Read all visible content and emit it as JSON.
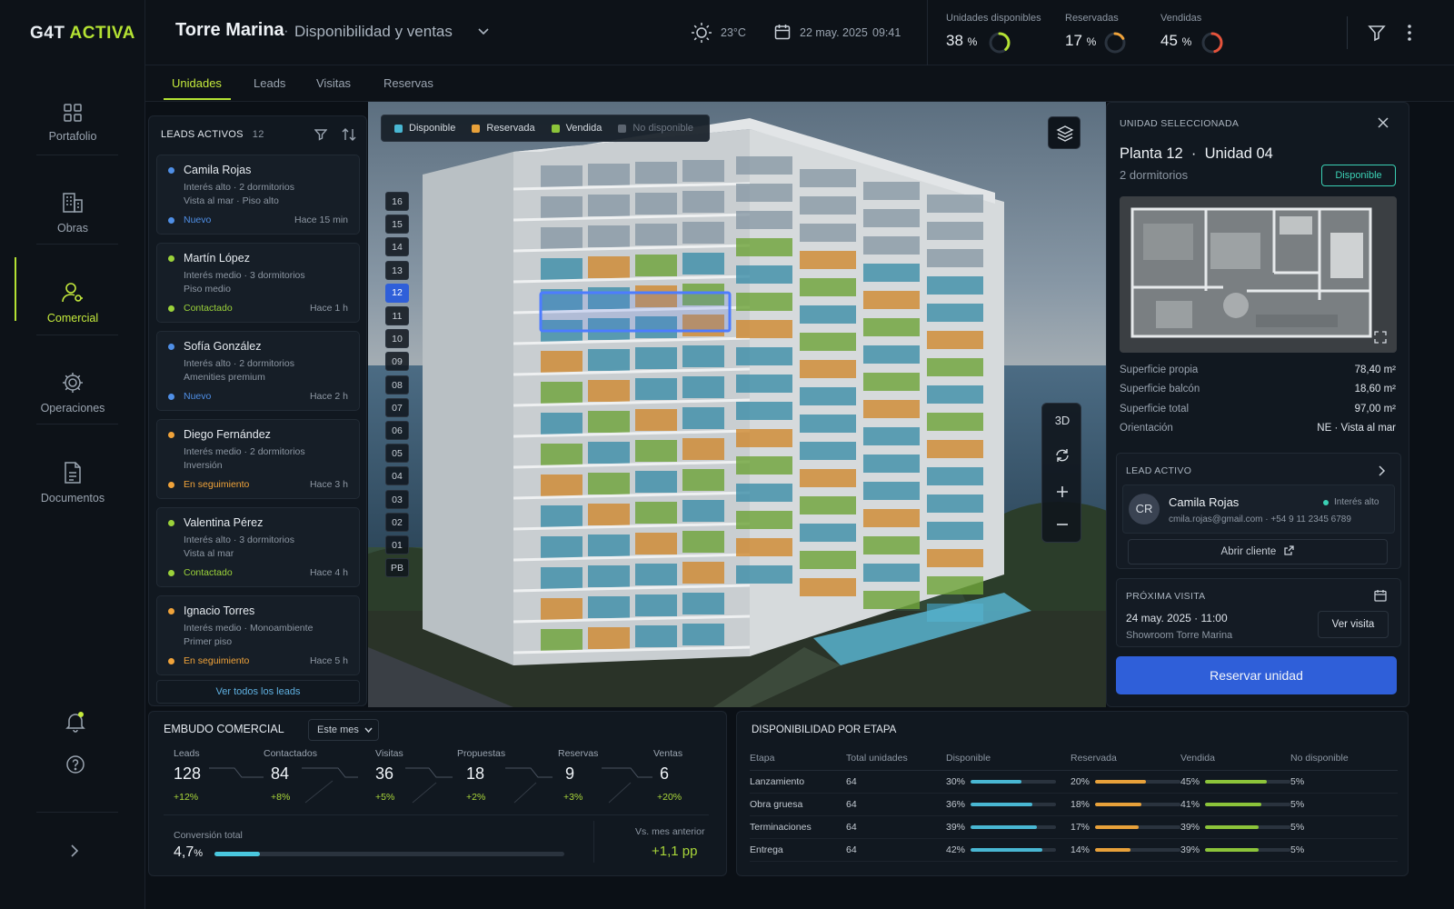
{
  "app": {
    "brand_a": "G4T",
    "brand_b": "ACTIVA"
  },
  "sidebar": {
    "items": [
      {
        "label": "Portafolio",
        "icon": "grid-icon"
      },
      {
        "label": "Obras",
        "icon": "building-icon"
      },
      {
        "label": "Comercial",
        "icon": "user-key-icon",
        "active": true
      },
      {
        "label": "Operaciones",
        "icon": "gear-icon"
      },
      {
        "label": "Documentos",
        "icon": "document-icon"
      }
    ]
  },
  "header": {
    "project": "Torre Marina",
    "separator": "·",
    "subtitle": "Disponibilidad y ventas",
    "temperature": "23°C",
    "date": "22 may. 2025",
    "time": "09:41",
    "kpis": [
      {
        "label": "Unidades disponibles",
        "value": "38",
        "unit": "%",
        "fraction": 0.38,
        "color": "#b4e233"
      },
      {
        "label": "Reservadas",
        "value": "17",
        "unit": "%",
        "fraction": 0.17,
        "color": "#f0a33a"
      },
      {
        "label": "Vendidas",
        "value": "45",
        "unit": "%",
        "fraction": 0.45,
        "color": "#e5533b"
      }
    ]
  },
  "tabs": [
    "Unidades",
    "Leads",
    "Visitas",
    "Reservas"
  ],
  "leads": {
    "title": "LEADS ACTIVOS",
    "count": "12",
    "items": [
      {
        "name": "Camila Rojas",
        "line1": "Interés alto · 2 dormitorios",
        "line2": "Vista al mar · Piso alto",
        "status": "Nuevo",
        "time": "Hace 15 min",
        "color": "#4f8fe6"
      },
      {
        "name": "Martín López",
        "line1": "Interés medio · 3 dormitorios",
        "line2": "Piso medio",
        "status": "Contactado",
        "time": "Hace 1 h",
        "color": "#9bd23a"
      },
      {
        "name": "Sofía González",
        "line1": "Interés alto · 2 dormitorios",
        "line2": "Amenities premium",
        "status": "Nuevo",
        "time": "Hace 2 h",
        "color": "#4f8fe6"
      },
      {
        "name": "Diego Fernández",
        "line1": "Interés medio · 2 dormitorios",
        "line2": "Inversión",
        "status": "En seguimiento",
        "time": "Hace 3 h",
        "color": "#f0a33a"
      },
      {
        "name": "Valentina Pérez",
        "line1": "Interés alto · 3 dormitorios",
        "line2": "Vista al mar",
        "status": "Contactado",
        "time": "Hace 4 h",
        "color": "#9bd23a"
      },
      {
        "name": "Ignacio Torres",
        "line1": "Interés medio · Monoambiente",
        "line2": "Primer piso",
        "status": "En seguimiento",
        "time": "Hace 5 h",
        "color": "#f0a33a"
      }
    ],
    "view_all": "Ver todos los leads"
  },
  "legend": [
    {
      "label": "Disponible",
      "color": "#49b7d3"
    },
    {
      "label": "Reservada",
      "color": "#e8a13a"
    },
    {
      "label": "Vendida",
      "color": "#8cc43a"
    },
    {
      "label": "No disponible",
      "color": "#5c6570"
    }
  ],
  "floors": [
    "16",
    "15",
    "14",
    "13",
    "12",
    "11",
    "10",
    "09",
    "08",
    "07",
    "06",
    "05",
    "04",
    "03",
    "02",
    "01",
    "PB"
  ],
  "selected_floor": "12",
  "view_controls": {
    "mode": "3D"
  },
  "unit": {
    "section": "UNIDAD SELECCIONADA",
    "floor": "Planta 12",
    "unit": "Unidad 04",
    "rooms": "2 dormitorios",
    "status": "Disponible",
    "specs": [
      {
        "label": "Superficie propia",
        "value": "78,40 m²"
      },
      {
        "label": "Superficie balcón",
        "value": "18,60 m²"
      },
      {
        "label": "Superficie total",
        "value": "97,00 m²"
      },
      {
        "label": "Orientación",
        "value": "NE  ·  Vista al mar"
      }
    ],
    "lead": {
      "section": "LEAD ACTIVO",
      "initials": "CR",
      "name": "Camila Rojas",
      "interest": "Interés alto",
      "email": "cmila.rojas@gmail.com",
      "phone": "+54 9 11 2345 6789",
      "open": "Abrir cliente"
    },
    "visit": {
      "section": "PRÓXIMA VISITA",
      "when": "24 may. 2025  ·  11:00",
      "where": "Showroom Torre Marina",
      "button": "Ver visita"
    },
    "reserve": "Reservar unidad"
  },
  "funnel": {
    "title": "EMBUDO COMERCIAL",
    "period": "Este mes",
    "stages": [
      {
        "label": "Leads",
        "value": "128",
        "delta": "+12%"
      },
      {
        "label": "Contactados",
        "value": "84",
        "delta": "+8%"
      },
      {
        "label": "Visitas",
        "value": "36",
        "delta": "+5%"
      },
      {
        "label": "Propuestas",
        "value": "18",
        "delta": "+2%"
      },
      {
        "label": "Reservas",
        "value": "9",
        "delta": "+3%"
      },
      {
        "label": "Ventas",
        "value": "6",
        "delta": "+20%"
      }
    ],
    "conversion_label": "Conversión total",
    "conversion_value": "4,7",
    "conversion_unit": "%",
    "conversion_fraction": 0.13,
    "compare_label": "Vs. mes anterior",
    "compare_value": "+1,1 pp"
  },
  "availability": {
    "title": "DISPONIBILIDAD POR ETAPA",
    "columns": [
      "Etapa",
      "Total unidades",
      "Disponible",
      "Reservada",
      "Vendida",
      "No disponible"
    ],
    "rows": [
      {
        "stage": "Lanzamiento",
        "total": "64",
        "disp": "30%",
        "res": "20%",
        "ven": "45%",
        "nd": "5%",
        "dv": 30,
        "rv": 20,
        "vv": 45
      },
      {
        "stage": "Obra gruesa",
        "total": "64",
        "disp": "36%",
        "res": "18%",
        "ven": "41%",
        "nd": "5%",
        "dv": 36,
        "rv": 18,
        "vv": 41
      },
      {
        "stage": "Terminaciones",
        "total": "64",
        "disp": "39%",
        "res": "17%",
        "ven": "39%",
        "nd": "5%",
        "dv": 39,
        "rv": 17,
        "vv": 39
      },
      {
        "stage": "Entrega",
        "total": "64",
        "disp": "42%",
        "res": "14%",
        "ven": "39%",
        "nd": "5%",
        "dv": 42,
        "rv": 14,
        "vv": 39
      }
    ]
  }
}
